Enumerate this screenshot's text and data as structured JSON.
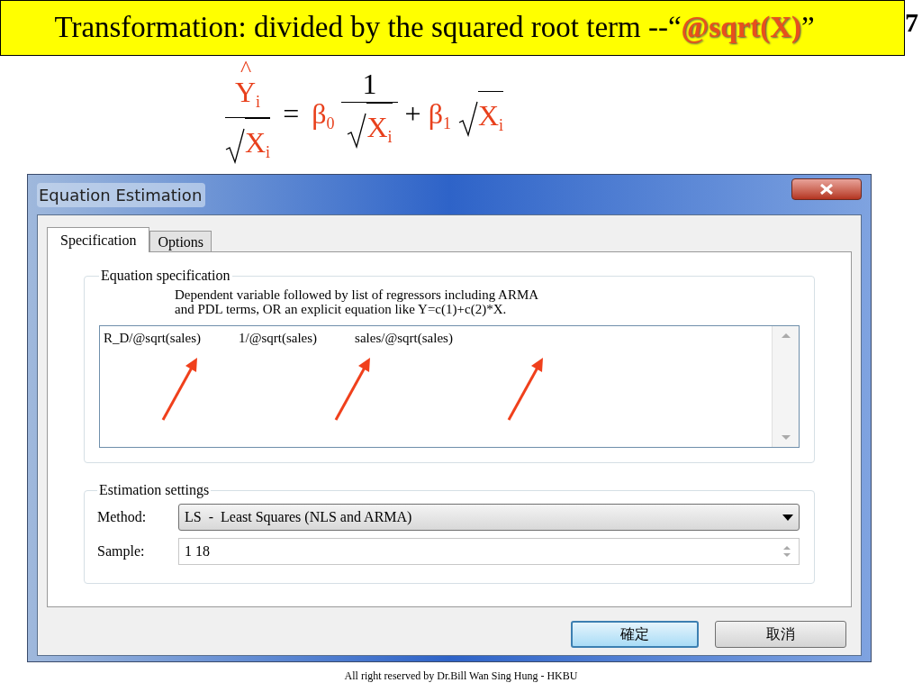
{
  "slide": {
    "title": "Transformation: divided by the squared root term --“**@sqrt(X)**”",
    "page_number": "7",
    "footer": "All right reserved by Dr.Bill Wan Sing Hung - HKBU"
  },
  "equation": {
    "lhs_num": {
      "hat": "^",
      "base": "Y",
      "sub": "i"
    },
    "lhs_den": {
      "base": "X",
      "sub": "i"
    },
    "equals": "=",
    "beta0": {
      "base": "β",
      "sub": "0"
    },
    "one": "1",
    "mid_den": {
      "base": "X",
      "sub": "i"
    },
    "plus": "+",
    "beta1": {
      "base": "β",
      "sub": "1"
    },
    "last": {
      "base": "X",
      "sub": "i"
    }
  },
  "dialog": {
    "title": "Equation Estimation",
    "tabs": [
      {
        "label": "Specification",
        "selected": true
      },
      {
        "label": "Options",
        "selected": false
      }
    ],
    "equation_spec": {
      "legend": "Equation specification",
      "description": "Dependent variable followed by list of regressors including ARMA\nand PDL terms, OR an explicit equation like Y=c(1)+c(2)*X.",
      "terms": [
        "R_D/@sqrt(sales)",
        "1/@sqrt(sales)",
        "sales/@sqrt(sales)"
      ]
    },
    "estimation_settings": {
      "legend": "Estimation settings",
      "method_label": "Method:",
      "method_value": "LS  -  Least Squares (NLS and ARMA)",
      "sample_label": "Sample:",
      "sample_value": "1 18"
    },
    "buttons": [
      {
        "label": "確定",
        "default": true
      },
      {
        "label": "取消",
        "default": false
      }
    ]
  }
}
